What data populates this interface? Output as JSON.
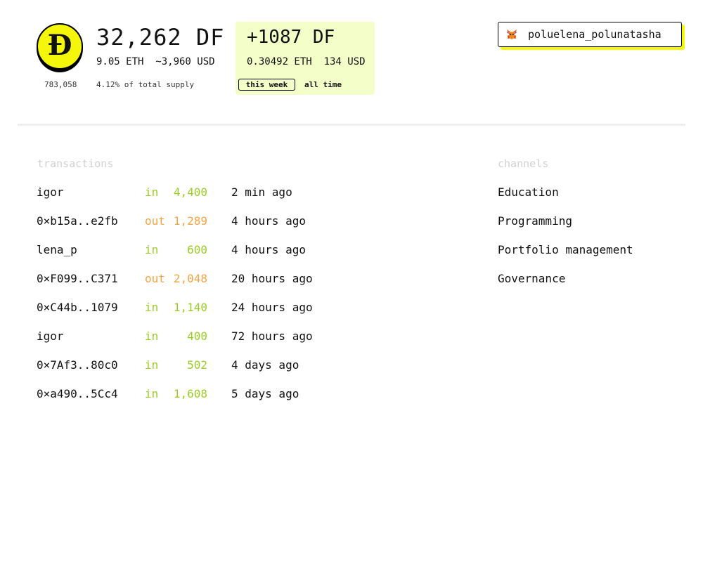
{
  "colors": {
    "accent_yellow": "#f4f70a",
    "week_bg": "#f3fec8",
    "in": "#9acd24",
    "out": "#f3a341",
    "muted": "#d0d0d0"
  },
  "logo": {
    "letter": "Ð",
    "icon": "df-coin-logo"
  },
  "balance": {
    "df": "32,262 DF",
    "eth_usd": "9.05 ETH  ~3,960 USD",
    "supply_count": "783,058",
    "supply_pct": "4.12% of total supply"
  },
  "week": {
    "df": "+1087 DF",
    "eth_usd": "0.30492 ETH  134 USD",
    "tab_week": "this week",
    "tab_all": "all time",
    "selected": "this week"
  },
  "user": {
    "icon": "metamask-fox-icon",
    "name": "poluelena_polunatasha"
  },
  "transactions": {
    "title": "transactions",
    "rows": [
      {
        "who": "igor",
        "dir": "in",
        "amount": "4,400",
        "time": "2 min ago"
      },
      {
        "who": "0×b15a..e2fb",
        "dir": "out",
        "amount": "1,289",
        "time": "4 hours ago"
      },
      {
        "who": "lena_p",
        "dir": "in",
        "amount": "600",
        "time": "4 hours ago"
      },
      {
        "who": "0×F099..C371",
        "dir": "out",
        "amount": "2,048",
        "time": "20 hours ago"
      },
      {
        "who": "0×C44b..1079",
        "dir": "in",
        "amount": "1,140",
        "time": "24 hours ago"
      },
      {
        "who": "igor",
        "dir": "in",
        "amount": "400",
        "time": "72 hours ago"
      },
      {
        "who": "0×7Af3..80c0",
        "dir": "in",
        "amount": "502",
        "time": "4 days ago"
      },
      {
        "who": "0×a490..5Cc4",
        "dir": "in",
        "amount": "1,608",
        "time": "5 days ago"
      }
    ]
  },
  "channels": {
    "title": "channels",
    "items": [
      "Education",
      "Programming",
      "Portfolio management",
      "Governance"
    ]
  }
}
